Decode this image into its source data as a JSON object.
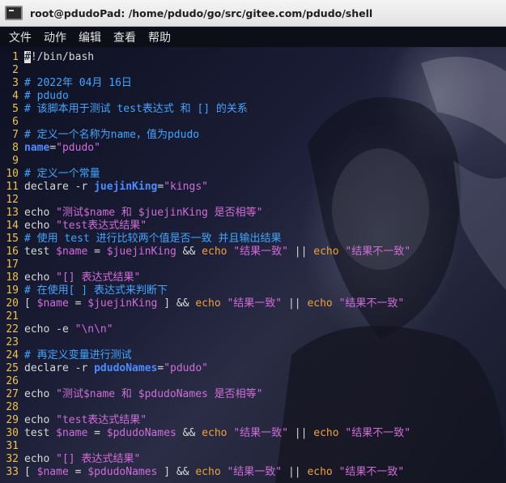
{
  "window": {
    "title": "root@pdudoPad: /home/pdudo/go/src/gitee.com/pdudo/shell",
    "icon": "terminal-icon"
  },
  "menu": [
    "文件",
    "动作",
    "编辑",
    "查看",
    "帮助"
  ],
  "colors": {
    "line_number": "#f0c14a",
    "comment": "#3ea6ff",
    "string": "#d06dd9",
    "bold_var": "#4b8cff",
    "echo": "#f0a23a",
    "plain": "#d8d8d8"
  },
  "lines": [
    {
      "n": "1",
      "parts": [
        [
          "cursor",
          "#"
        ],
        [
          "plain",
          "!/bin/bash"
        ]
      ]
    },
    {
      "n": "2",
      "parts": []
    },
    {
      "n": "3",
      "parts": [
        [
          "comment",
          "# 2022年 04月 16日"
        ]
      ]
    },
    {
      "n": "4",
      "parts": [
        [
          "comment",
          "# pdudo"
        ]
      ]
    },
    {
      "n": "5",
      "parts": [
        [
          "comment",
          "# 该脚本用于测试 test表达式 和 [] 的关系"
        ]
      ]
    },
    {
      "n": "6",
      "parts": []
    },
    {
      "n": "7",
      "parts": [
        [
          "comment",
          "# 定义一个名称为name，值为pdudo"
        ]
      ]
    },
    {
      "n": "8",
      "parts": [
        [
          "bold",
          "name"
        ],
        [
          "plain",
          "="
        ],
        [
          "string",
          "\"pdudo\""
        ]
      ]
    },
    {
      "n": "9",
      "parts": []
    },
    {
      "n": "10",
      "parts": [
        [
          "comment",
          "# 定义一个常量"
        ]
      ]
    },
    {
      "n": "11",
      "parts": [
        [
          "plain",
          "declare -r "
        ],
        [
          "bold",
          "juejinKing"
        ],
        [
          "plain",
          "="
        ],
        [
          "string",
          "\"kings\""
        ]
      ]
    },
    {
      "n": "12",
      "parts": []
    },
    {
      "n": "13",
      "parts": [
        [
          "plain",
          "echo "
        ],
        [
          "string",
          "\"测试$name 和 $juejinKing 是否相等\""
        ]
      ]
    },
    {
      "n": "14",
      "parts": [
        [
          "plain",
          "echo "
        ],
        [
          "string",
          "\"test表达式结果\""
        ]
      ]
    },
    {
      "n": "15",
      "parts": [
        [
          "comment",
          "# 使用 test 进行比较两个值是否一致 并且输出结果"
        ]
      ]
    },
    {
      "n": "16",
      "parts": [
        [
          "plain",
          "test "
        ],
        [
          "var",
          "$name"
        ],
        [
          "plain",
          " = "
        ],
        [
          "var",
          "$juejinKing"
        ],
        [
          "plain",
          " && "
        ],
        [
          "echo",
          "echo"
        ],
        [
          "plain",
          " "
        ],
        [
          "string",
          "\"结果一致\""
        ],
        [
          "plain",
          " || "
        ],
        [
          "echo",
          "echo"
        ],
        [
          "plain",
          " "
        ],
        [
          "string",
          "\"结果不一致\""
        ]
      ]
    },
    {
      "n": "17",
      "parts": []
    },
    {
      "n": "18",
      "parts": [
        [
          "plain",
          "echo "
        ],
        [
          "string",
          "\"[] 表达式结果\""
        ]
      ]
    },
    {
      "n": "19",
      "parts": [
        [
          "comment",
          "# 在使用[ ] 表达式来判断下"
        ]
      ]
    },
    {
      "n": "20",
      "parts": [
        [
          "plain",
          "[ "
        ],
        [
          "var",
          "$name"
        ],
        [
          "plain",
          " = "
        ],
        [
          "var",
          "$juejinKing"
        ],
        [
          "plain",
          " ] && "
        ],
        [
          "echo",
          "echo"
        ],
        [
          "plain",
          " "
        ],
        [
          "string",
          "\"结果一致\""
        ],
        [
          "plain",
          " || "
        ],
        [
          "echo",
          "echo"
        ],
        [
          "plain",
          " "
        ],
        [
          "string",
          "\"结果不一致\""
        ]
      ]
    },
    {
      "n": "21",
      "parts": []
    },
    {
      "n": "22",
      "parts": [
        [
          "plain",
          "echo -e "
        ],
        [
          "string",
          "\"\\n\\n\""
        ]
      ]
    },
    {
      "n": "23",
      "parts": []
    },
    {
      "n": "24",
      "parts": [
        [
          "comment",
          "# 再定义变量进行测试"
        ]
      ]
    },
    {
      "n": "25",
      "parts": [
        [
          "plain",
          "declare -r "
        ],
        [
          "bold",
          "pdudoNames"
        ],
        [
          "plain",
          "="
        ],
        [
          "string",
          "\"pdudo\""
        ]
      ]
    },
    {
      "n": "26",
      "parts": []
    },
    {
      "n": "27",
      "parts": [
        [
          "plain",
          "echo "
        ],
        [
          "string",
          "\"测试$name 和 $pdudoNames 是否相等\""
        ]
      ]
    },
    {
      "n": "28",
      "parts": []
    },
    {
      "n": "29",
      "parts": [
        [
          "plain",
          "echo "
        ],
        [
          "string",
          "\"test表达式结果\""
        ]
      ]
    },
    {
      "n": "30",
      "parts": [
        [
          "plain",
          "test "
        ],
        [
          "var",
          "$name"
        ],
        [
          "plain",
          " = "
        ],
        [
          "var",
          "$pdudoNames"
        ],
        [
          "plain",
          " && "
        ],
        [
          "echo",
          "echo"
        ],
        [
          "plain",
          " "
        ],
        [
          "string",
          "\"结果一致\""
        ],
        [
          "plain",
          " || "
        ],
        [
          "echo",
          "echo"
        ],
        [
          "plain",
          " "
        ],
        [
          "string",
          "\"结果不一致\""
        ]
      ]
    },
    {
      "n": "31",
      "parts": []
    },
    {
      "n": "32",
      "parts": [
        [
          "plain",
          "echo "
        ],
        [
          "string",
          "\"[] 表达式结果\""
        ]
      ]
    },
    {
      "n": "33",
      "parts": [
        [
          "plain",
          "[ "
        ],
        [
          "var",
          "$name"
        ],
        [
          "plain",
          " = "
        ],
        [
          "var",
          "$pdudoNames"
        ],
        [
          "plain",
          " ] && "
        ],
        [
          "echo",
          "echo"
        ],
        [
          "plain",
          " "
        ],
        [
          "string",
          "\"结果一致\""
        ],
        [
          "plain",
          " || "
        ],
        [
          "echo",
          "echo"
        ],
        [
          "plain",
          " "
        ],
        [
          "string",
          "\"结果不一致\""
        ]
      ]
    }
  ]
}
